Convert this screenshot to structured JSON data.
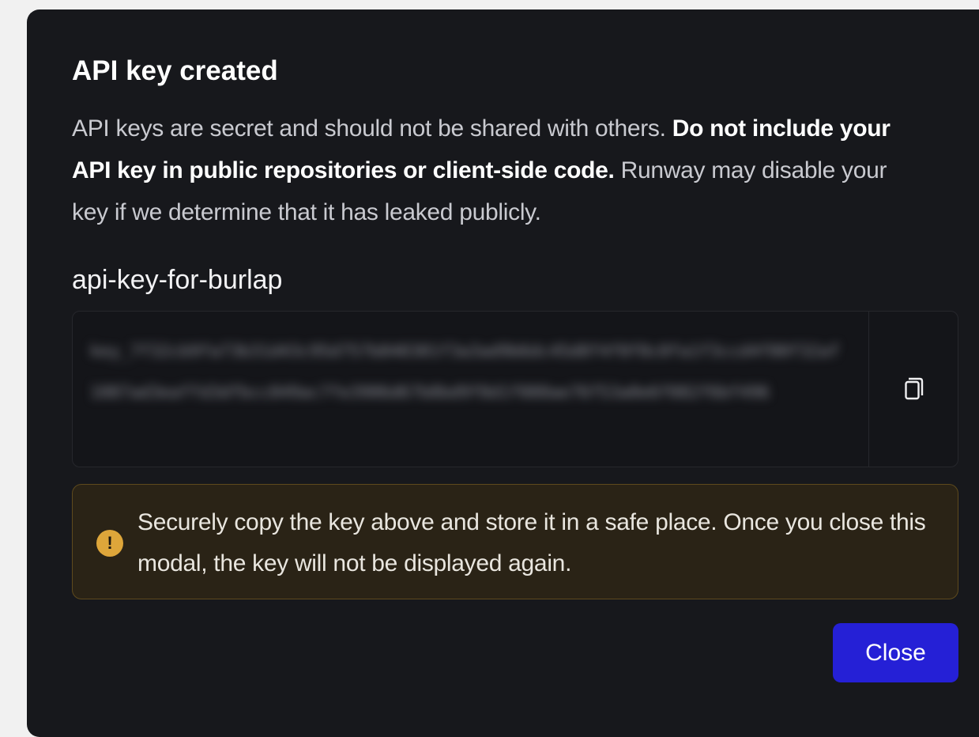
{
  "modal": {
    "title": "API key created",
    "description": {
      "intro": "API keys are secret and should not be shared with others. ",
      "emphasis": "Do not include your API key in public repositories or client-side code.",
      "outro": " Runway may disable your key if we determine that it has leaked publicly."
    },
    "key_name": "api-key-for-burlap",
    "key_value": "key_7f32cb9fa73b31d43c95d757b840301f3a3ad9b6dc45d8f4f0f8c0fa1f3ccd4f80f32af1087ad3eaffd3dfbcc849ac7fe3906d67b8bd9f8d1f080ae76f53a0e6f082f6bf496",
    "key_blurred": true,
    "copy_icon": "copy-icon",
    "warning": {
      "icon": "exclamation-icon",
      "text": "Securely copy the key above and store it in a safe place. Once you close this modal, the key will not be displayed again."
    },
    "close_label": "Close"
  },
  "colors": {
    "modal_bg": "#17181c",
    "warning_bg": "#2a2316",
    "warning_border": "#5e4a1d",
    "warning_icon": "#dea63a",
    "primary_button": "#2520d6"
  }
}
